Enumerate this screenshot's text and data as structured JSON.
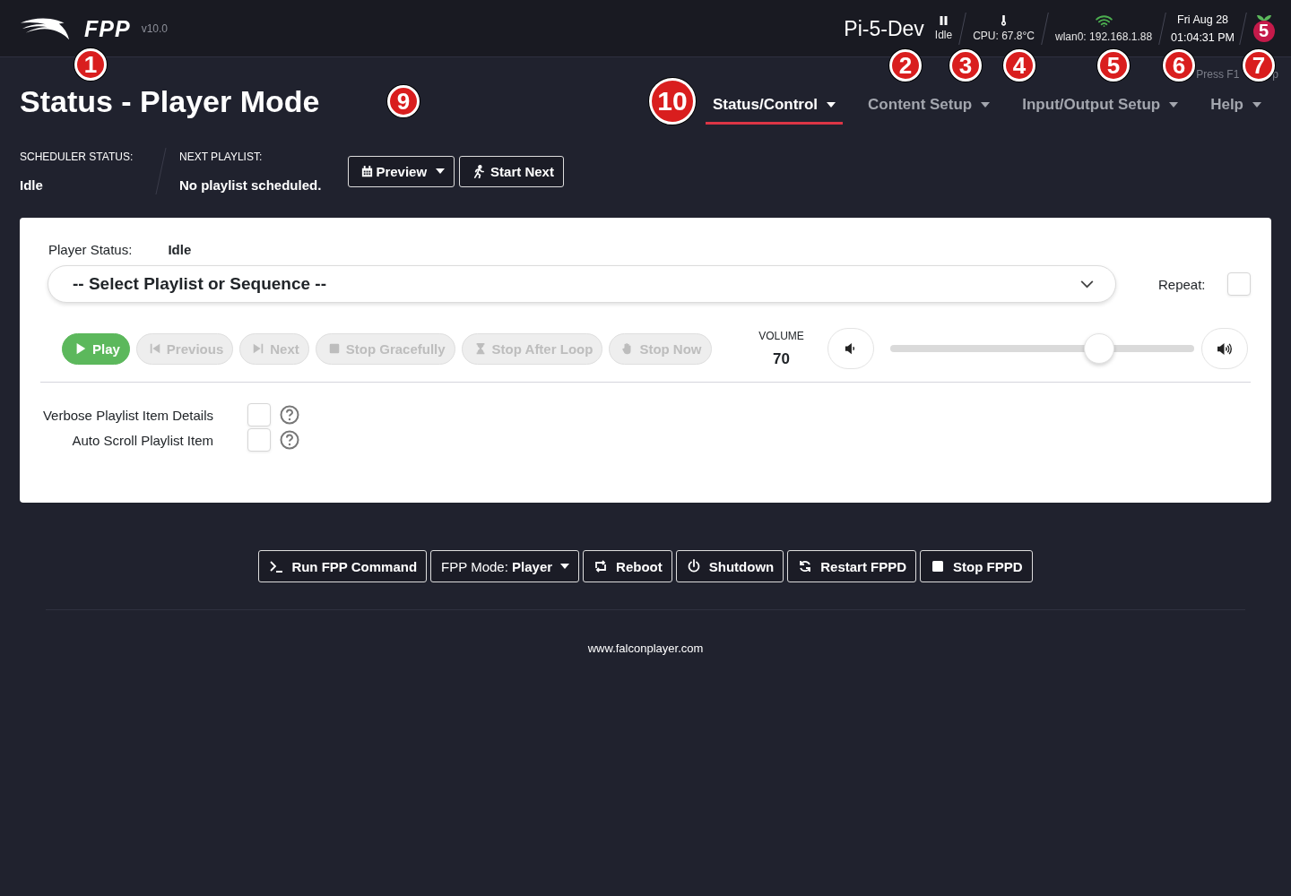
{
  "header": {
    "logo_text": "FPP",
    "version": "v10.0",
    "hostname": "Pi-5-Dev",
    "player_state": "Idle",
    "cpu": "CPU: 67.8°C",
    "network": "wlan0: 192.168.1.88",
    "date": "Fri Aug 28",
    "time": "01:04:31 PM",
    "board_badge": "5"
  },
  "hint": [
    "Press F1",
    "p"
  ],
  "page_title": "Status - Player Mode",
  "nav": [
    {
      "label": "Status/Control",
      "selected": true
    },
    {
      "label": "Content Setup",
      "selected": false
    },
    {
      "label": "Input/Output Setup",
      "selected": false
    },
    {
      "label": "Help",
      "selected": false
    }
  ],
  "scheduler": {
    "status_label": "SCHEDULER STATUS:",
    "status": "Idle",
    "next_label": "NEXT PLAYLIST:",
    "next": "No playlist scheduled."
  },
  "scheduler_buttons": [
    {
      "label": "Preview",
      "kind": "calendar",
      "dropdown": true
    },
    {
      "label": "Start Next",
      "kind": "runner",
      "dropdown": false
    }
  ],
  "player": {
    "status_label": "Player Status:",
    "status": "Idle",
    "select_value": "-- Select Playlist or Sequence --",
    "repeat_label": "Repeat:",
    "repeat": false,
    "controls": [
      {
        "label": "Play",
        "kind": "play",
        "disabled": false
      },
      {
        "label": "Previous",
        "kind": "previous",
        "disabled": true
      },
      {
        "label": "Next",
        "kind": "next",
        "disabled": true
      },
      {
        "label": "Stop Gracefully",
        "kind": "stop",
        "disabled": true
      },
      {
        "label": "Stop After Loop",
        "kind": "hourglass",
        "disabled": true
      },
      {
        "label": "Stop Now",
        "kind": "hand",
        "disabled": true
      }
    ],
    "volume_label": "VOLUME",
    "volume": "70",
    "volume_slider": {
      "level": 0.69
    },
    "options": [
      {
        "label": "Verbose Playlist Item Details",
        "checked": false
      },
      {
        "label": "Auto Scroll Playlist Item",
        "checked": false
      }
    ]
  },
  "actions": [
    {
      "label": "Run FPP Command",
      "kind": "terminal",
      "dropdown": false
    },
    {
      "label": "FPP Mode: **Player**",
      "kind": "mode",
      "dropdown": true
    },
    {
      "label": "Reboot",
      "kind": "reboot",
      "dropdown": false
    },
    {
      "label": "Shutdown",
      "kind": "power",
      "dropdown": false
    },
    {
      "label": "Restart FPPD",
      "kind": "restart",
      "dropdown": false
    },
    {
      "label": "Stop FPPD",
      "kind": "square",
      "dropdown": false
    }
  ],
  "footer": "www.falconplayer.com",
  "markers": [
    {
      "label": "1"
    },
    {
      "label": "2"
    },
    {
      "label": "3"
    },
    {
      "label": "4"
    },
    {
      "label": "5"
    },
    {
      "label": "6"
    },
    {
      "label": "7"
    },
    {
      "label": "9"
    },
    {
      "label": "10"
    }
  ]
}
